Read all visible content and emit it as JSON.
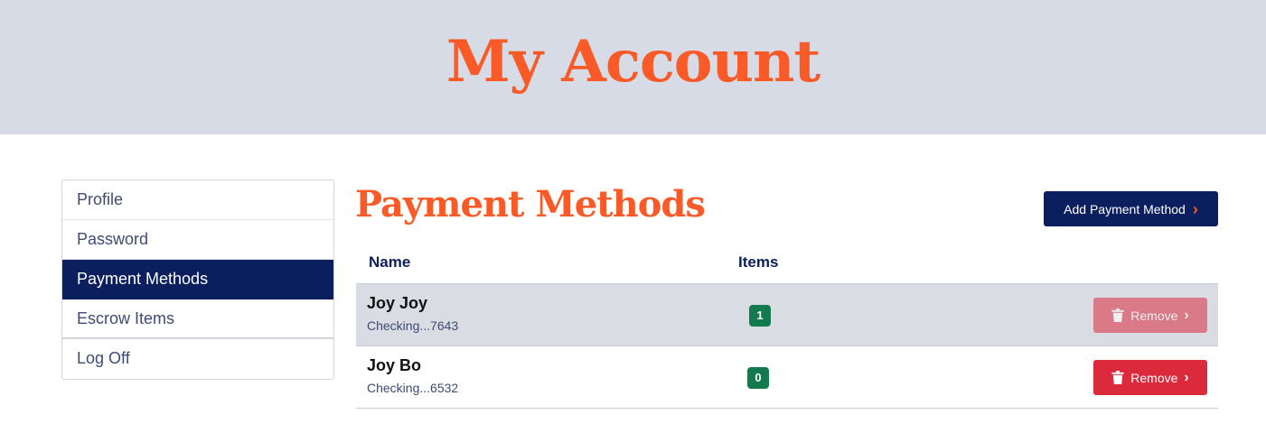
{
  "header": {
    "title": "My Account"
  },
  "sidebar": {
    "items": [
      {
        "label": "Profile"
      },
      {
        "label": "Password"
      },
      {
        "label": "Payment Methods",
        "active": true
      },
      {
        "label": "Escrow Items"
      },
      {
        "label": "Log Off"
      }
    ]
  },
  "main": {
    "title": "Payment Methods",
    "add_button": {
      "label": "Add Payment Method",
      "icon": "chevron-right-icon"
    },
    "table": {
      "columns": [
        "Name",
        "Items"
      ],
      "rows": [
        {
          "name": "Joy Joy",
          "account": "Checking...7643",
          "items": "1",
          "action": "Remove",
          "action_state": "disabled"
        },
        {
          "name": "Joy Bo",
          "account": "Checking...6532",
          "items": "0",
          "action": "Remove",
          "action_state": "enabled"
        }
      ]
    }
  },
  "colors": {
    "accent": "#fa5a27",
    "navy": "#0b1f5e",
    "success": "#137a4d",
    "danger": "#dc2a3d",
    "hero_bg": "#d6dbe6"
  }
}
